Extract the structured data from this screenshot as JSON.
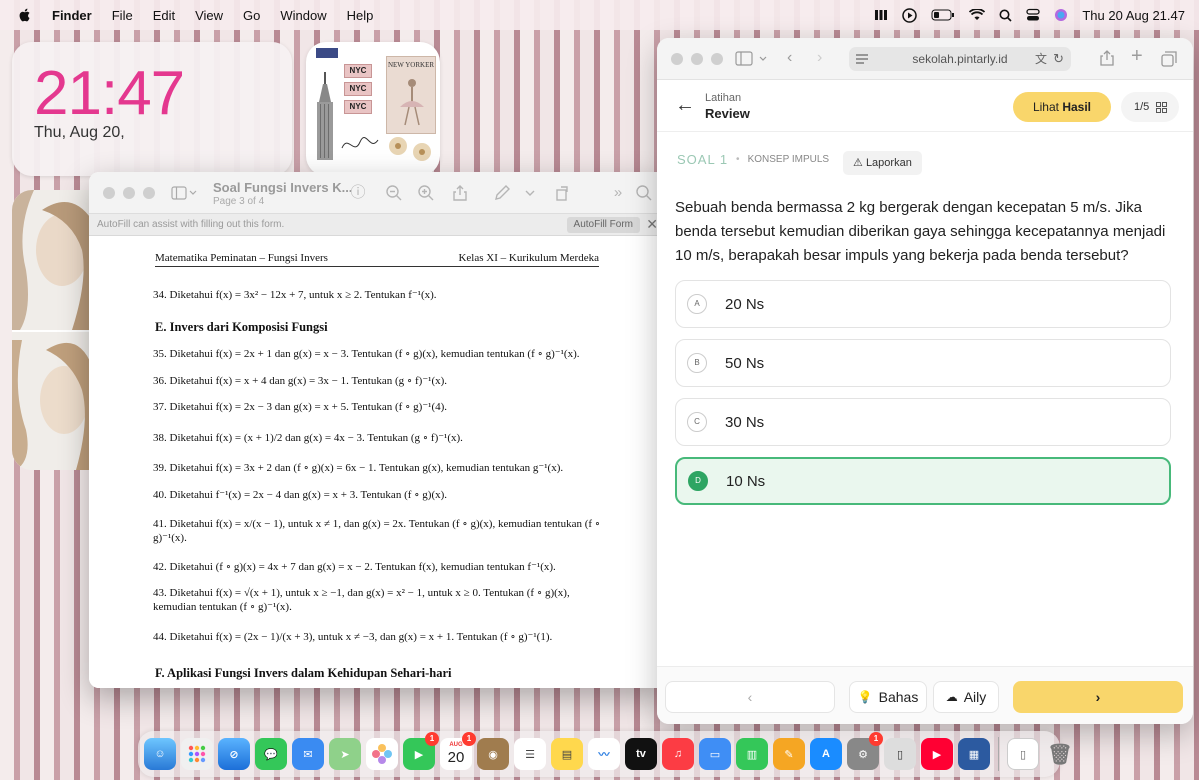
{
  "menubar": {
    "app_name": "Finder",
    "items": [
      "File",
      "Edit",
      "View",
      "Go",
      "Window",
      "Help"
    ],
    "datetime": "Thu 20 Aug  21.47"
  },
  "clock_widget": {
    "time": "21:47",
    "date": "Thu, Aug 20,"
  },
  "photo_widget": {
    "badge_texts": [
      "NYC",
      "NYC",
      "NYC"
    ],
    "card_title": "NEW YORKER"
  },
  "pdf_window": {
    "title": "Soal Fungsi Invers K...",
    "subtitle": "Page 3 of 4",
    "autofill_text": "AutoFill can assist with filling out this form.",
    "autofill_button": "AutoFill Form",
    "header_left": "Matematika Peminatan – Fungsi Invers",
    "header_right": "Kelas XI – Kurikulum Merdeka",
    "section_e": "E. Invers dari Komposisi Fungsi",
    "section_f": "F. Aplikasi Fungsi Invers dalam Kehidupan Sehari-hari",
    "questions": [
      "34. Diketahui f(x) = 3x² − 12x + 7, untuk x ≥ 2. Tentukan f⁻¹(x).",
      "35. Diketahui f(x) = 2x + 1 dan g(x) = x − 3. Tentukan (f ∘ g)(x), kemudian tentukan (f ∘ g)⁻¹(x).",
      "36. Diketahui f(x) = x + 4 dan g(x) = 3x − 1. Tentukan (g ∘ f)⁻¹(x).",
      "37. Diketahui f(x) = 2x − 3 dan g(x) = x + 5. Tentukan (f ∘ g)⁻¹(4).",
      "38. Diketahui f(x) = (x + 1)/2 dan g(x) = 4x − 3. Tentukan (g ∘ f)⁻¹(x).",
      "39. Diketahui f(x) = 3x + 2 dan (f ∘ g)(x) = 6x − 1. Tentukan g(x), kemudian tentukan g⁻¹(x).",
      "40. Diketahui f⁻¹(x) = 2x − 4 dan g(x) = x + 3. Tentukan (f ∘ g)(x).",
      "41. Diketahui f(x) = x/(x − 1), untuk x ≠ 1, dan g(x) = 2x. Tentukan (f ∘ g)(x), kemudian tentukan (f ∘ g)⁻¹(x).",
      "42. Diketahui (f ∘ g)(x) = 4x + 7 dan g(x) = x − 2. Tentukan f(x), kemudian tentukan f⁻¹(x).",
      "43. Diketahui f(x) = √(x + 1), untuk x ≥ −1, dan g(x) = x² − 1, untuk x ≥ 0. Tentukan (f ∘ g)(x), kemudian tentukan (f ∘ g)⁻¹(x).",
      "44. Diketahui f(x) = (2x − 1)/(x + 3), untuk x ≠ −3, dan g(x) = x + 1. Tentukan (f ∘ g)⁻¹(1)."
    ]
  },
  "quiz": {
    "url": "sekolah.pintarly.id",
    "header_small": "Latihan",
    "header_big": "Review",
    "lihat_prefix": "Lihat ",
    "lihat_bold": "Hasil",
    "page_count": "1/5",
    "soal_tag": "SOAL 1",
    "soal_topic": "KONSEP IMPULS",
    "laporkan": "Laporkan",
    "question": "Sebuah benda bermassa 2 kg bergerak dengan kecepatan 5 m/s. Jika benda tersebut kemudian diberikan gaya sehingga kecepatannya menjadi 10 m/s, berapakah besar impuls yang bekerja pada benda tersebut?",
    "options": [
      {
        "letter": "A",
        "text": "20 Ns"
      },
      {
        "letter": "B",
        "text": "50 Ns"
      },
      {
        "letter": "C",
        "text": "30 Ns"
      },
      {
        "letter": "D",
        "text": "10 Ns"
      }
    ],
    "correct_option": "D",
    "footer": {
      "bahas": "Bahas",
      "aily": "Aily"
    },
    "colors": {
      "accent_yellow": "#f9d66b",
      "correct_green": "#47b97a"
    }
  },
  "dock": {
    "calendar_month": "AUG",
    "calendar_day": "20",
    "badge_facetime": "1",
    "badge_calendar": "1",
    "badge_appstore": "1",
    "tv_label": "tv"
  }
}
